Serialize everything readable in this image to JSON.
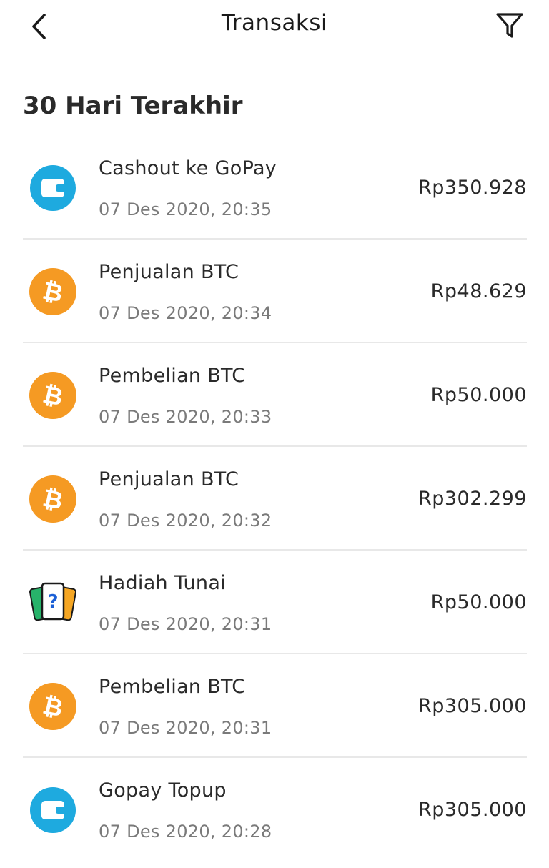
{
  "header": {
    "title": "Transaksi",
    "back_icon": "chevron-left-icon",
    "filter_icon": "filter-icon"
  },
  "section": {
    "title": "30 Hari Terakhir"
  },
  "colors": {
    "gopay": "#1eaadf",
    "bitcoin": "#f59a23",
    "text": "#2a2a2a",
    "muted": "#7a7a7a",
    "divider": "#e8e8e8"
  },
  "transactions": [
    {
      "icon": "gopay-wallet-icon",
      "name": "Cashout ke GoPay",
      "date": "07 Des 2020, 20:35",
      "amount": "Rp350.928"
    },
    {
      "icon": "bitcoin-icon",
      "name": "Penjualan BTC",
      "date": "07 Des 2020, 20:34",
      "amount": "Rp48.629"
    },
    {
      "icon": "bitcoin-icon",
      "name": "Pembelian BTC",
      "date": "07 Des 2020, 20:33",
      "amount": "Rp50.000"
    },
    {
      "icon": "bitcoin-icon",
      "name": "Penjualan BTC",
      "date": "07 Des 2020, 20:32",
      "amount": "Rp302.299"
    },
    {
      "icon": "mystery-cards-icon",
      "name": "Hadiah Tunai",
      "date": "07 Des 2020, 20:31",
      "amount": "Rp50.000"
    },
    {
      "icon": "bitcoin-icon",
      "name": "Pembelian BTC",
      "date": "07 Des 2020, 20:31",
      "amount": "Rp305.000"
    },
    {
      "icon": "gopay-wallet-icon",
      "name": "Gopay Topup",
      "date": "07 Des 2020, 20:28",
      "amount": "Rp305.000"
    }
  ]
}
